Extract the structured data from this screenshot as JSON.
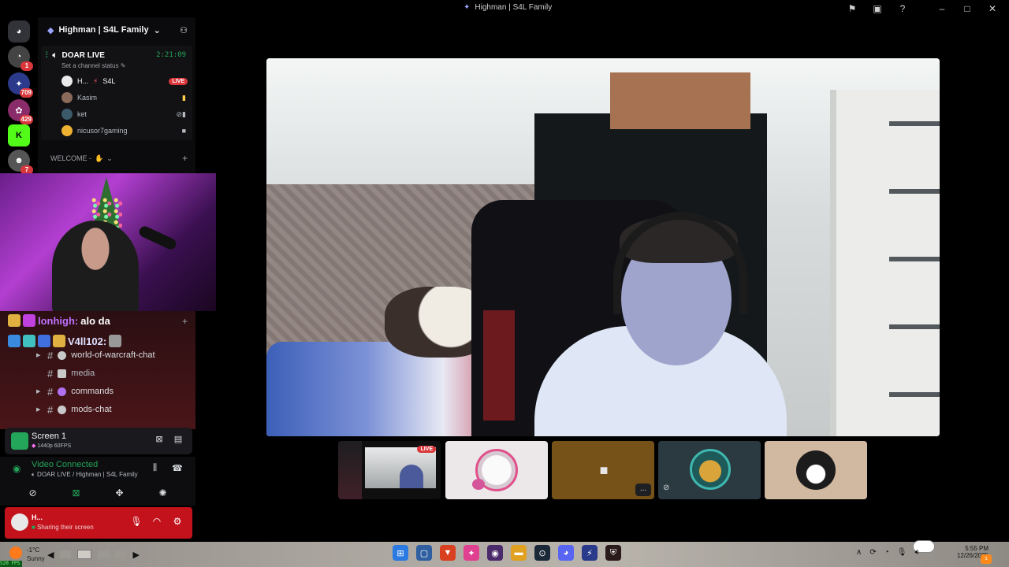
{
  "window": {
    "title": "Highman | S4L Family"
  },
  "titlebar_icons": [
    "inbox-flag-icon",
    "screen-share-icon",
    "help-icon",
    "minimize-icon",
    "maximize-icon",
    "close-icon"
  ],
  "rail": {
    "badges": [
      "1",
      "709",
      "429",
      "7"
    ]
  },
  "server": {
    "name": "Highman | S4L Family"
  },
  "voice_channel": {
    "name": "DOAR LIVE",
    "timer": "2:21:09",
    "status_hint": "Set a channel status",
    "users": [
      {
        "name": "H...",
        "tag": "S4L",
        "live": "LIVE"
      },
      {
        "name": "Kasim"
      },
      {
        "name": "ket"
      },
      {
        "name": "nicusor7gaming"
      }
    ]
  },
  "categories": {
    "welcome": "WELCOME -"
  },
  "chat_overlay": {
    "line1_user": "lonhigh:",
    "line1_msg": "alo da",
    "line2_user": "V4ll102:"
  },
  "channels": [
    {
      "name": "world-of-warcraft-chat",
      "style": "bold"
    },
    {
      "name": "media",
      "style": "muted"
    },
    {
      "name": "commands",
      "style": "bold"
    },
    {
      "name": "mods-chat",
      "style": "bold"
    }
  ],
  "screen_share": {
    "title": "Screen 1",
    "quality": "1440p 60FPS"
  },
  "voice_connection": {
    "title": "Video Connected",
    "channel": "DOAR LIVE / Highman | S4L Family"
  },
  "user_panel": {
    "name": "H...",
    "status": "Sharing their screen"
  },
  "thumbnails": {
    "live_label": "LIVE",
    "more_label": "..."
  },
  "taskbar": {
    "temp": "-1°C",
    "weather": "Sunny",
    "fps": "520 FPS",
    "time": "5:55 PM",
    "date": "12/26/2025",
    "notif_count": "1"
  },
  "colors": {
    "discord_bg": "#0b0b0d",
    "green": "#23a55a",
    "live_red": "#da373c",
    "user_panel_red": "#c3121c"
  }
}
